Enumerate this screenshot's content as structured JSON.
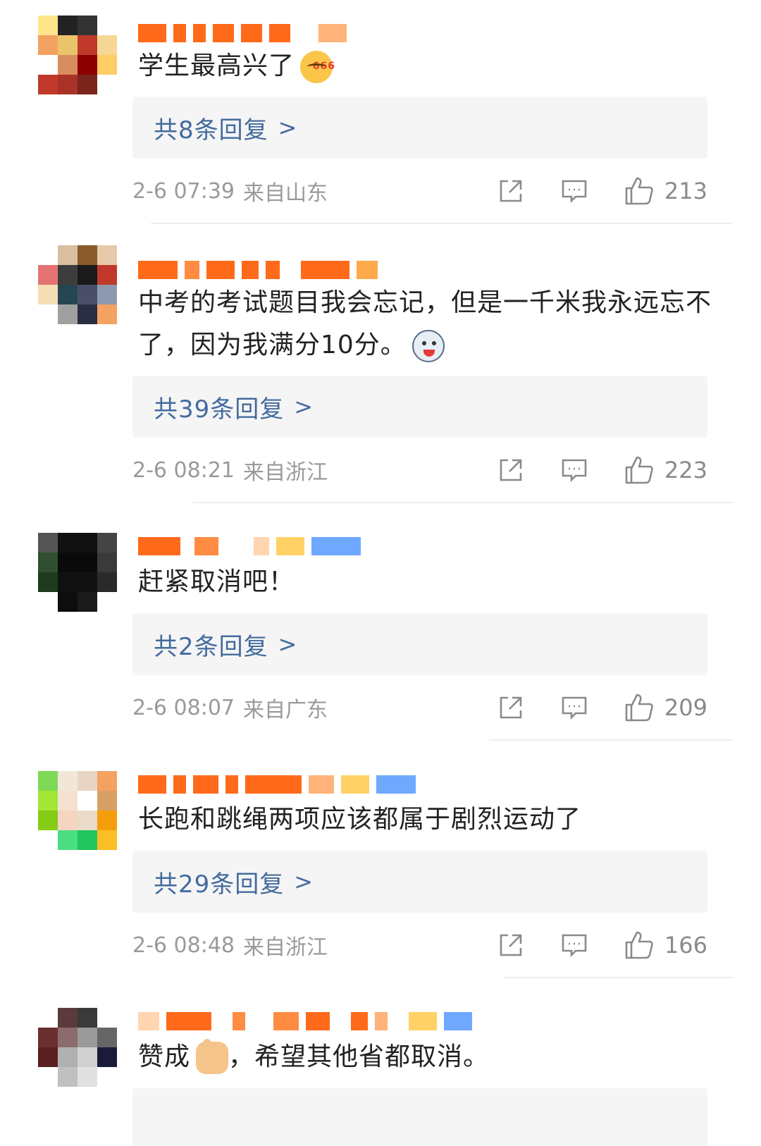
{
  "comments": [
    {
      "text": "学生最高兴了",
      "emoji_icon": "666-emoji-icon",
      "replies_label": "共8条回复",
      "replies_chevron": ">",
      "time": "2-6 07:39",
      "location": "来自山东",
      "likes": "213"
    },
    {
      "text": "中考的考试题目我会忘记，但是一千米我永远忘不了，因为我满分10分。",
      "emoji_icon": "husky-emoji-icon",
      "replies_label": "共39条回复",
      "replies_chevron": ">",
      "time": "2-6 08:21",
      "location": "来自浙江",
      "likes": "223"
    },
    {
      "text": "赶紧取消吧！",
      "replies_label": "共2条回复",
      "replies_chevron": ">",
      "time": "2-6 08:07",
      "location": "来自广东",
      "likes": "209"
    },
    {
      "text": "长跑和跳绳两项应该都属于剧烈运动了",
      "replies_label": "共29条回复",
      "replies_chevron": ">",
      "time": "2-6 08:48",
      "location": "来自浙江",
      "likes": "166"
    },
    {
      "text_before": "赞成",
      "emoji_icon": "thumbs-up-emoji-icon",
      "text_after": "，希望其他省都取消。"
    }
  ],
  "icons": {
    "share": "share-icon",
    "comment": "comment-icon",
    "like": "like-icon"
  },
  "colors": {
    "reply_link": "#436b9e",
    "meta_text": "#9a9a9a",
    "reply_box": "#f5f5f5"
  }
}
